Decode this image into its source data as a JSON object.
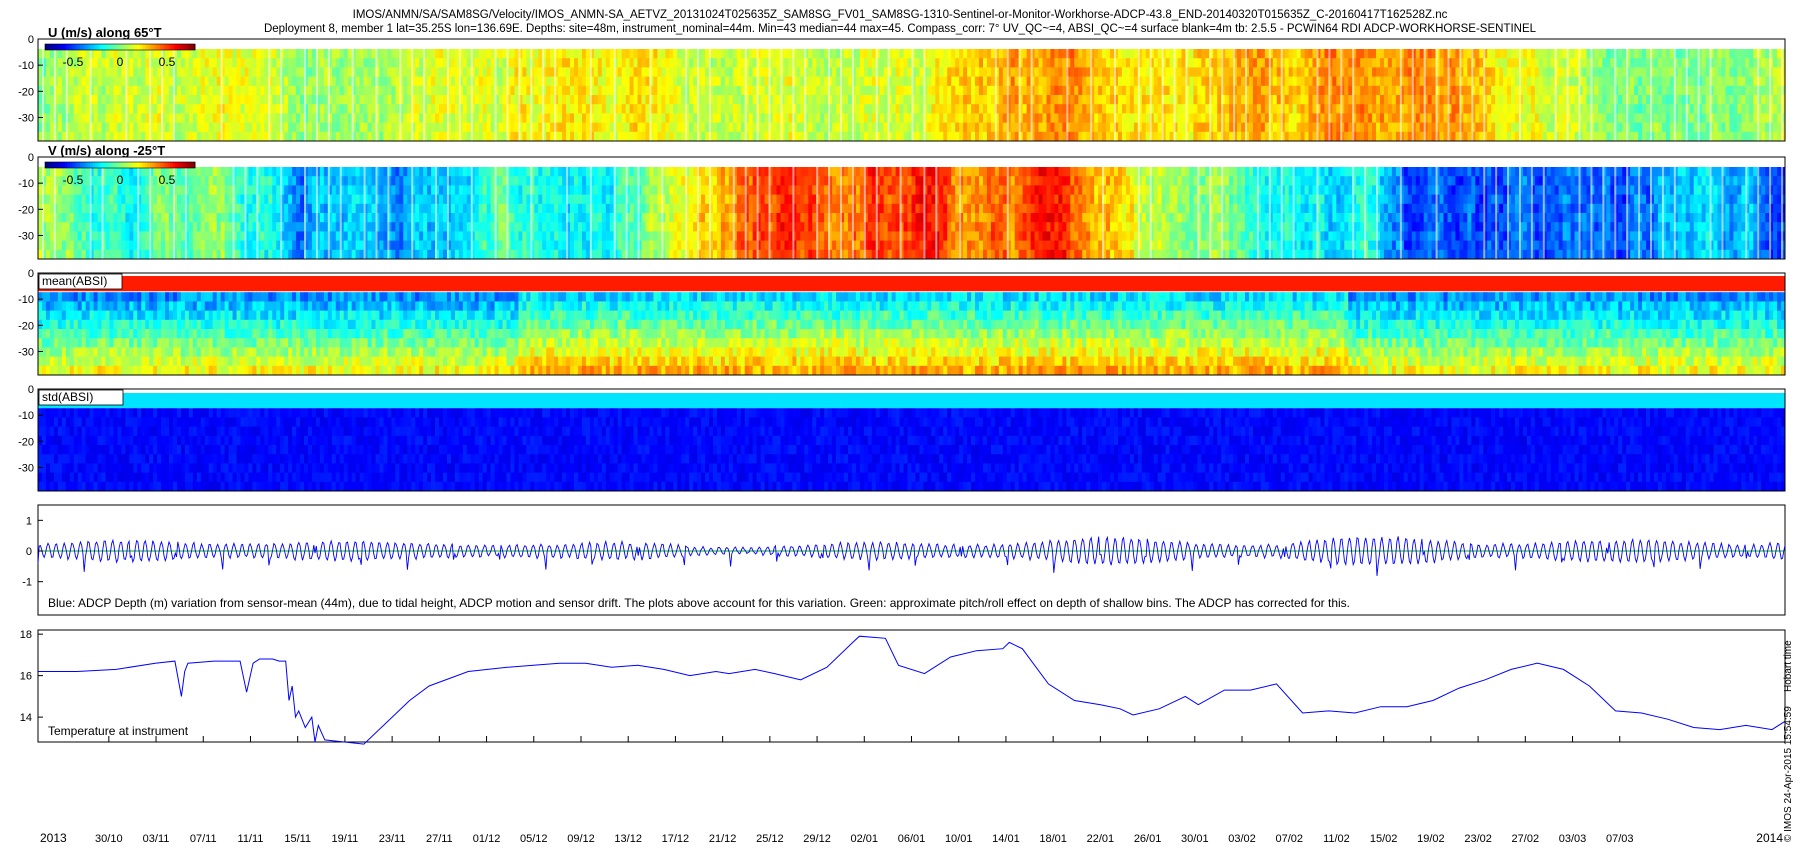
{
  "header": {
    "line1": "IMOS/ANMN/SA/SAM8SG/Velocity/IMOS_ANMN-SA_AETVZ_20131024T025635Z_SAM8SG_FV01_SAM8SG-1310-Sentinel-or-Monitor-Workhorse-ADCP-43.8_END-20140320T015635Z_C-20160417T162528Z.nc",
    "line2": "Deployment 8, member 1 lat=35.25S lon=136.69E. Depths: site=48m, instrument_nominal=44m. Min=43 median=44 max=45. Compass_corr: 7° UV_QC~=4, ABSI_QC~=4 surface blank=4m tb: 2.5.5 - PCWIN64 RDI ADCP-WORKHORSE-SENTINEL"
  },
  "footer": {
    "credit": "© IMOS 24-Apr-2015 15:54:59",
    "timezone": "Hobart time"
  },
  "chart_data": [
    {
      "type": "heatmap",
      "title": "U (m/s) along 65°T",
      "y_ticks": [
        "0",
        "-10",
        "-20",
        "-30"
      ],
      "ylim": [
        -39,
        0
      ],
      "colorbar": {
        "ticks": [
          "-0.5",
          "0",
          "0.5"
        ],
        "range": [
          -0.7,
          0.7
        ],
        "colormap": "jet"
      },
      "value_pattern": {
        "min": -0.55,
        "max": 0.55
      }
    },
    {
      "type": "heatmap",
      "title": "V (m/s) along -25°T",
      "y_ticks": [
        "0",
        "-10",
        "-20",
        "-30"
      ],
      "ylim": [
        -39,
        0
      ],
      "colorbar": {
        "ticks": [
          "-0.5",
          "0",
          "0.5"
        ],
        "range": [
          -0.7,
          0.7
        ],
        "colormap": "jet"
      },
      "value_pattern": {
        "min": -0.55,
        "max": 0.55
      }
    },
    {
      "type": "heatmap",
      "title": "mean(ABSI)",
      "y_ticks": [
        "0",
        "-10",
        "-20",
        "-30"
      ],
      "ylim": [
        -39,
        0
      ],
      "colormap": "jet"
    },
    {
      "type": "heatmap",
      "title": "std(ABSI)",
      "y_ticks": [
        "0",
        "-10",
        "-20",
        "-30"
      ],
      "ylim": [
        -39,
        0
      ],
      "colormap": "jet"
    },
    {
      "type": "line",
      "annotation": "Blue: ADCP Depth (m) variation from sensor-mean (44m), due to tidal height, ADCP motion and sensor drift. The plots above account for this variation. Green: approximate pitch/roll effect on depth of shallow bins. The ADCP has corrected for this.",
      "y_ticks": [
        "1",
        "0",
        "-1"
      ],
      "ylim": [
        -1.5,
        1.5
      ],
      "series": [
        {
          "color": "#0000ff",
          "amplitude_envelope": [
            0.25,
            0.35,
            0.45,
            0.35,
            0.3,
            0.4,
            0.25,
            0.3,
            0.2,
            0.25,
            0.3,
            0.4,
            0.45,
            0.4,
            0.35,
            0.45,
            0.5,
            0.4,
            0.35,
            0.4,
            0.45
          ]
        },
        {
          "color": "#00b000",
          "value": 0
        }
      ]
    },
    {
      "type": "line",
      "annotation": "Temperature at instrument",
      "y_ticks": [
        "18",
        "16",
        "14"
      ],
      "ylim": [
        12.8,
        18.2
      ],
      "series": [
        {
          "color": "#0000ff",
          "x_day": [
            0,
            6,
            12,
            18,
            21,
            22,
            22.5,
            23,
            27,
            31,
            32,
            33,
            34,
            35,
            36,
            37,
            38,
            38.5,
            39,
            39.5,
            40,
            41,
            42,
            42.5,
            43,
            44,
            50,
            57,
            60,
            66,
            72,
            76,
            80,
            84,
            88,
            92,
            96,
            100,
            104,
            106,
            110,
            113,
            117,
            121,
            125,
            126,
            130,
            132,
            136,
            140,
            144,
            148,
            149,
            151,
            155,
            159,
            163,
            166,
            168,
            172,
            176,
            178,
            182,
            186,
            190,
            194,
            198,
            202,
            206,
            210,
            214,
            218,
            222,
            226,
            230,
            234,
            238,
            242,
            246,
            250,
            254,
            258,
            262,
            266,
            268
          ],
          "y": [
            16.2,
            16.2,
            16.3,
            16.6,
            16.7,
            15.0,
            16.2,
            16.6,
            16.7,
            16.7,
            15.2,
            16.6,
            16.8,
            16.8,
            16.8,
            16.7,
            16.7,
            14.8,
            15.5,
            14.0,
            14.3,
            13.5,
            14.0,
            12.8,
            13.6,
            12.9,
            12.7,
            14.8,
            15.5,
            16.2,
            16.4,
            16.5,
            16.6,
            16.6,
            16.4,
            16.5,
            16.3,
            16.0,
            16.2,
            16.1,
            16.3,
            16.1,
            15.8,
            16.4,
            17.6,
            17.9,
            17.8,
            16.5,
            16.1,
            16.9,
            17.2,
            17.3,
            17.6,
            17.3,
            15.6,
            14.8,
            14.6,
            14.4,
            14.1,
            14.4,
            15.0,
            14.6,
            15.3,
            15.3,
            15.6,
            14.2,
            14.3,
            14.2,
            14.5,
            14.5,
            14.8,
            15.4,
            15.8,
            16.3,
            16.6,
            16.3,
            15.5,
            14.3,
            14.2,
            13.9,
            13.5,
            13.4,
            13.6,
            13.4,
            13.8
          ]
        }
      ]
    }
  ],
  "time_axis": {
    "start_date": "2013-10-24T02:56:35",
    "range_days": [
      0,
      148
    ],
    "year_left": "2013",
    "year_right": "2014",
    "tick_labels": [
      "30/10",
      "03/11",
      "07/11",
      "11/11",
      "15/11",
      "19/11",
      "23/11",
      "27/11",
      "01/12",
      "05/12",
      "09/12",
      "13/12",
      "17/12",
      "21/12",
      "25/12",
      "29/12",
      "02/01",
      "06/01",
      "10/01",
      "14/01",
      "18/01",
      "22/01",
      "26/01",
      "30/01",
      "03/02",
      "07/02",
      "11/02",
      "15/02",
      "19/02",
      "23/02",
      "27/02",
      "03/03",
      "07/03"
    ],
    "tick_days": [
      6,
      10,
      14,
      18,
      22,
      26,
      30,
      34,
      38,
      42,
      46,
      50,
      54,
      58,
      62,
      66,
      70,
      74,
      78,
      82,
      86,
      90,
      94,
      98,
      102,
      106,
      110,
      114,
      118,
      122,
      126,
      130,
      134
    ]
  }
}
